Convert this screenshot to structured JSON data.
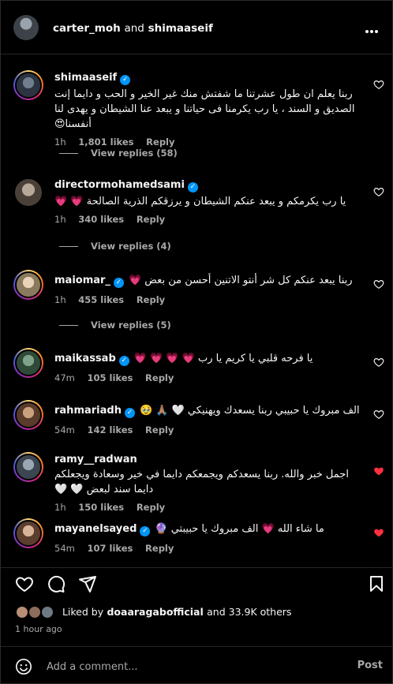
{
  "header": {
    "user1": "carter_moh",
    "and": "and",
    "user2": "shimaaseif"
  },
  "comments": [
    {
      "username": "shimaaseif",
      "verified": true,
      "text": "ربنا يعلم ان طول عشرتنا ما شفتش منك غير الخير و الحب و دايما إنت الصديق و السند ، يا رب يكرمنا فى حياتنا و يبعد عنا الشيطان و يهدى لنا أنفسنا😍",
      "time": "1h",
      "likes": "1,801 likes",
      "reply": "Reply",
      "liked": false,
      "view_replies": "View replies (58)"
    },
    {
      "username": "directormohamedsami",
      "verified": true,
      "text": "يا رب يكرمكم و يبعد عنكم الشيطان و يرزقكم الذرية الصالحة 💗 💗",
      "time": "1h",
      "likes": "340 likes",
      "reply": "Reply",
      "liked": false,
      "view_replies": "View replies (4)"
    },
    {
      "username": "maiomar_",
      "verified": true,
      "text": "ربنا يبعد عنكم كل شر أنتو الاتنين أحسن من بعض 💗",
      "time": "1h",
      "likes": "455 likes",
      "reply": "Reply",
      "liked": false,
      "view_replies": "View replies (5)"
    },
    {
      "username": "maikassab",
      "verified": true,
      "text": "يا فرحه قلبي يا كريم يا رب 💗 💗 💗 💗",
      "time": "47m",
      "likes": "105 likes",
      "reply": "Reply",
      "liked": false
    },
    {
      "username": "rahmariadh",
      "verified": true,
      "text": "الف مبروك يا حبيبي ربنا يسعدك ويهنيكي 🤍 🙏🏽 🥹",
      "time": "54m",
      "likes": "142 likes",
      "reply": "Reply",
      "liked": false
    },
    {
      "username": "ramy__radwan",
      "verified": false,
      "text": "اجمل خبر والله. ربنا يسعدكم ويجمعكم دايما في خير وسعادة ويجعلكم دايما سند لبعض 🤍 🤍",
      "time": "1h",
      "likes": "150 likes",
      "reply": "Reply",
      "liked": true
    },
    {
      "username": "mayanelsayed",
      "verified": true,
      "text": "ما شاء الله 💗 الف مبروك يا حبيبتي 🔮",
      "time": "54m",
      "likes": "107 likes",
      "reply": "Reply",
      "liked": true
    }
  ],
  "footer": {
    "liked_by_prefix": "Liked by",
    "liked_by_user": "doaaragabofficial",
    "and_others": "and 33.9K others",
    "time_ago": "1 hour ago",
    "add_comment_placeholder": "Add a comment...",
    "post_label": "Post"
  },
  "colors": {
    "background": "#000000",
    "text": "#f5f5f5",
    "secondary_text": "#a8a8a8",
    "verified": "#0095f6",
    "liked_heart": "#ff3040"
  }
}
